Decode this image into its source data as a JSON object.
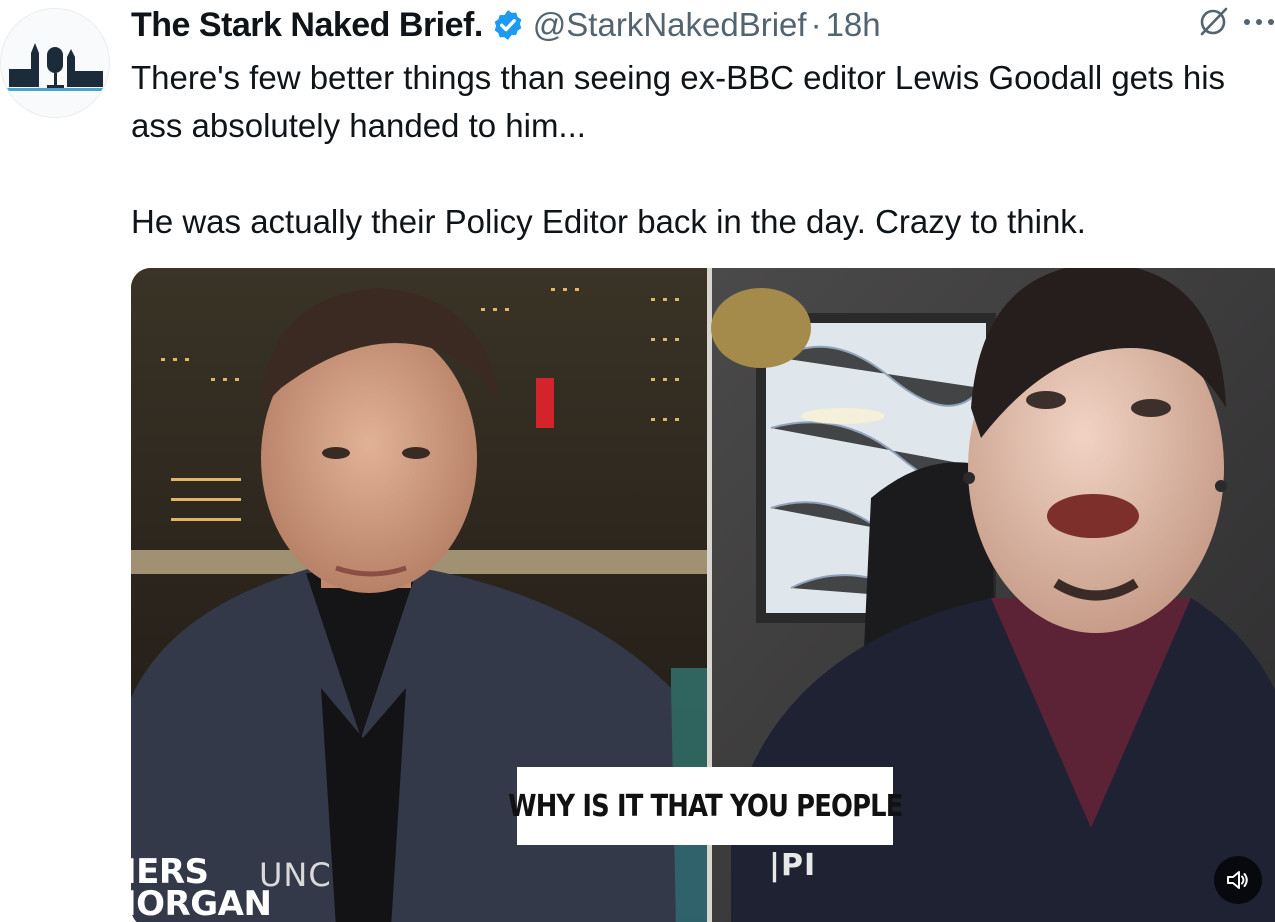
{
  "author": {
    "display_name": "The Stark Naked Brief.",
    "handle": "@StarkNakedBrief",
    "separator": "·",
    "time": "18h",
    "verified": true,
    "avatar_icon": "parliament-microphone-logo"
  },
  "tweet": {
    "paragraphs": [
      "There's few better things than seeing ex-BBC editor Lewis Goodall gets his ass absolutely handed to him...",
      "He was actually their Policy Editor back in the day. Crazy to think."
    ]
  },
  "media": {
    "type": "video",
    "caption": "WHY IS IT THAT YOU PEOPLE",
    "show_logo": "IERS\nIORGAN",
    "left_logo_fragment": "UNC",
    "right_logo_fragment": "|PI",
    "mute_icon": "speaker-icon"
  },
  "colors": {
    "verified_blue": "#1d9bf0",
    "secondary_text": "#536471"
  }
}
